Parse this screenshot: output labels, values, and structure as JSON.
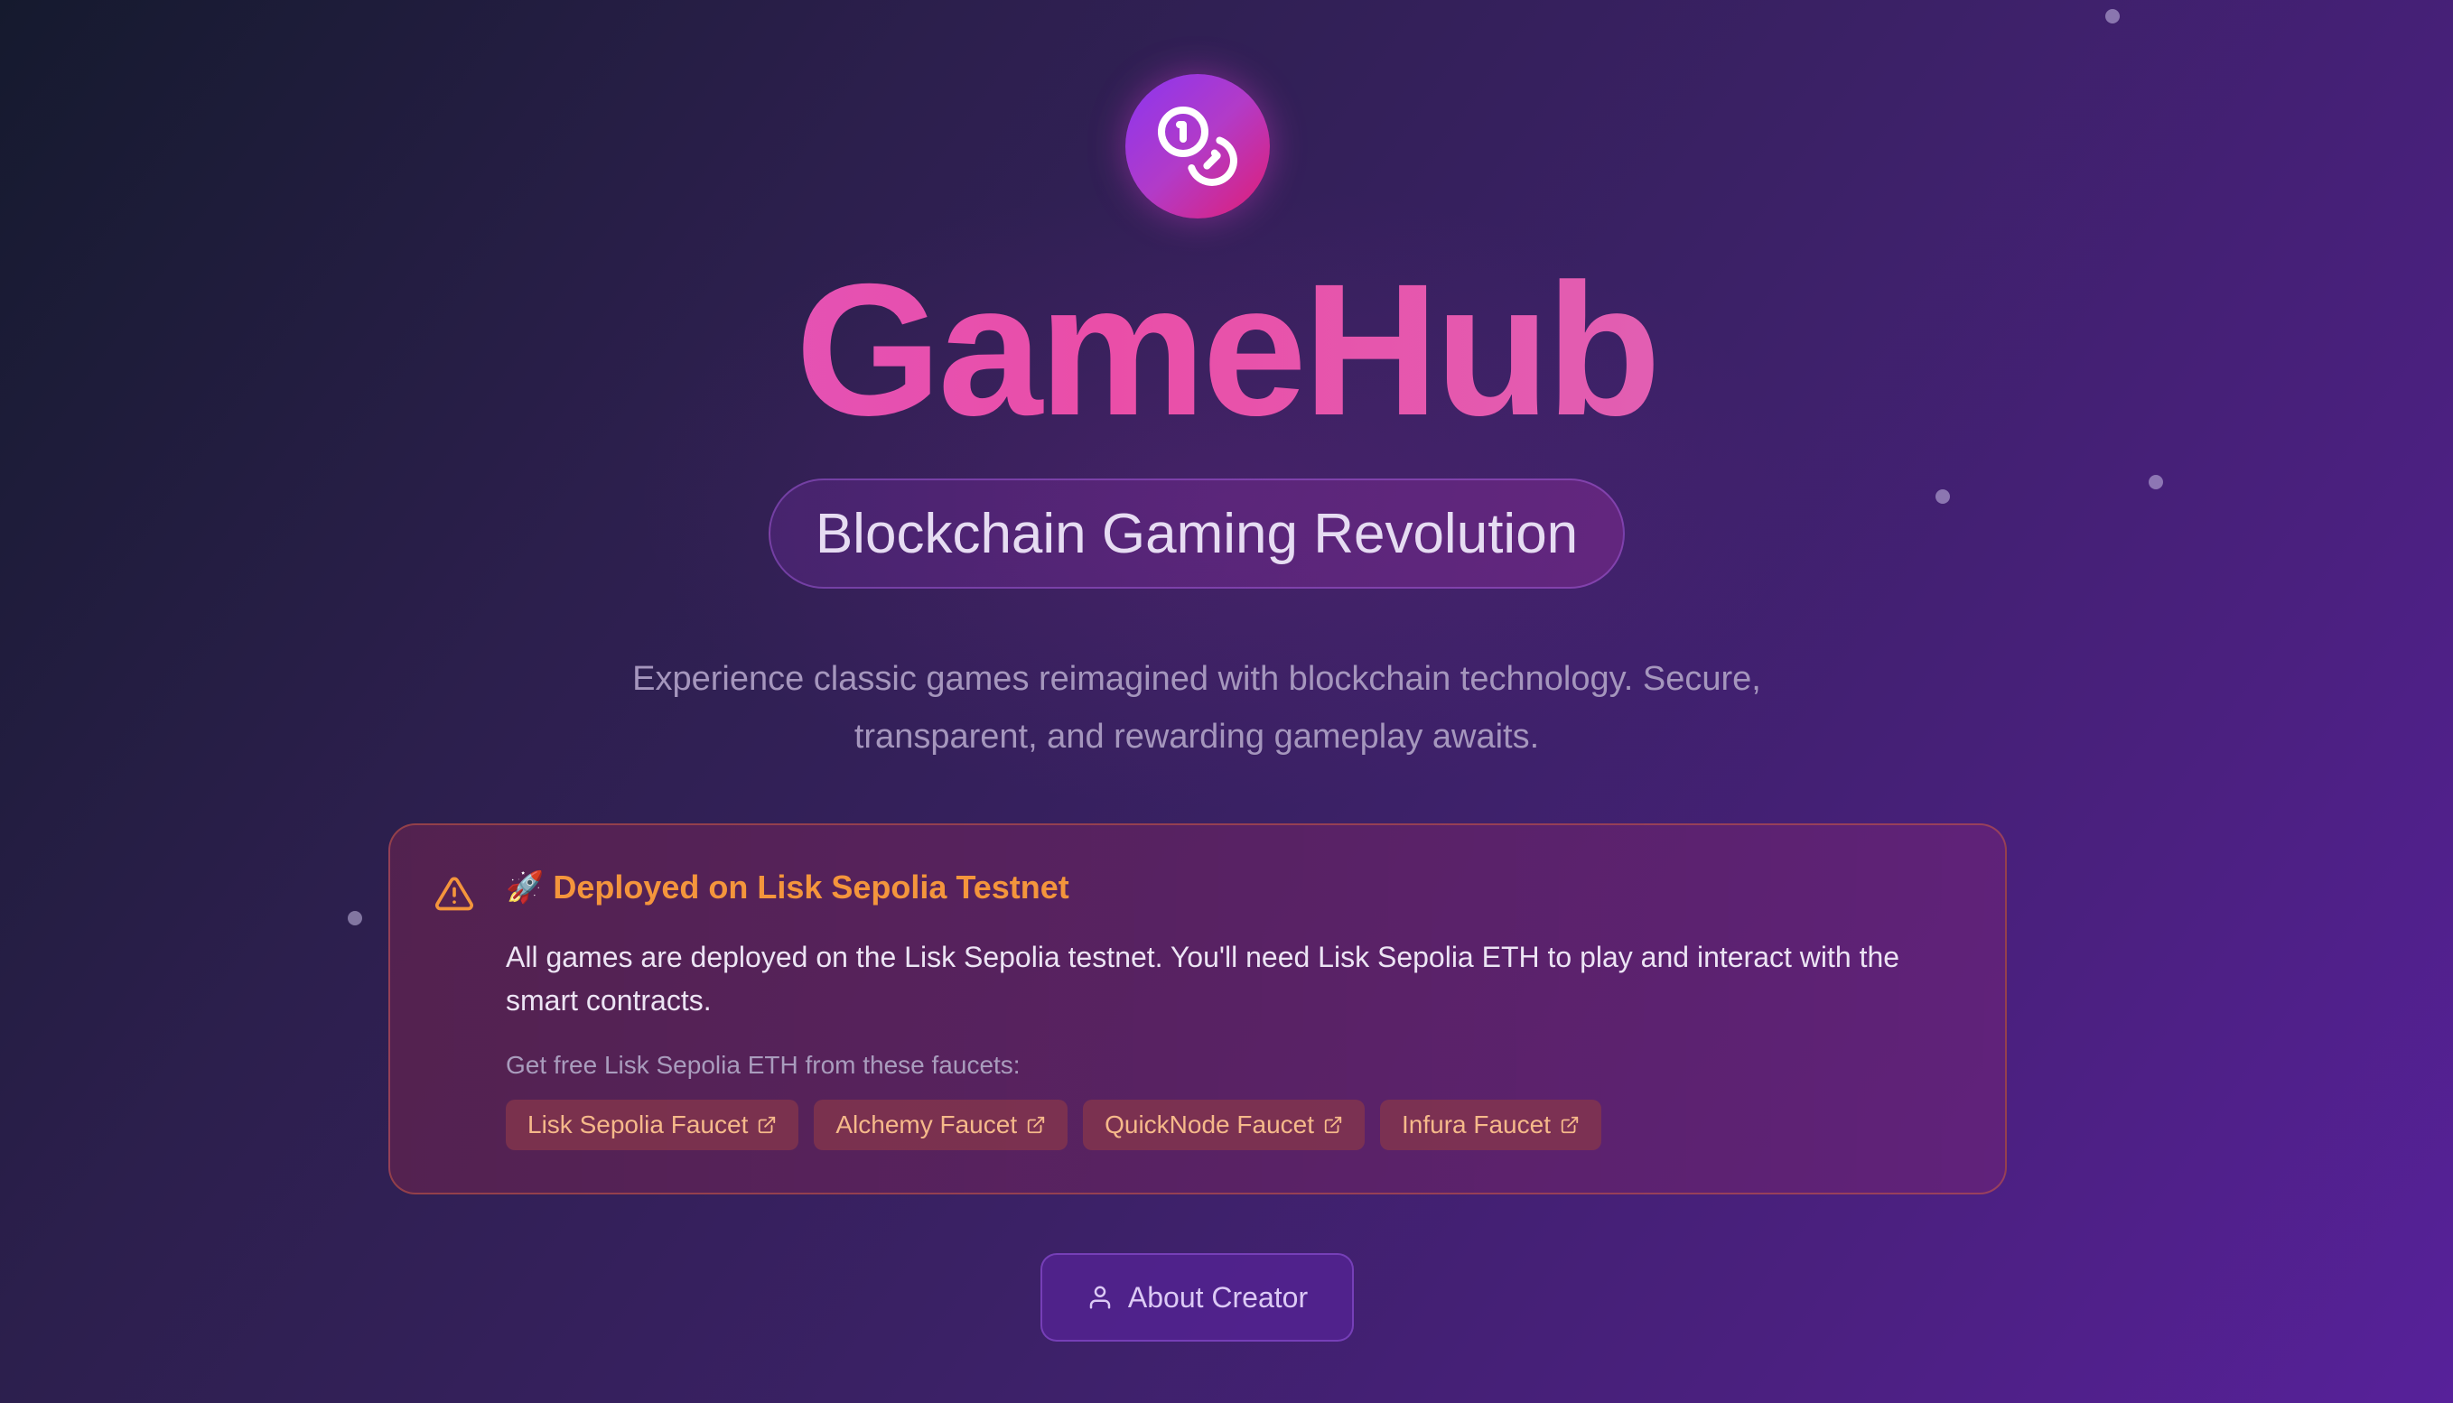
{
  "hero": {
    "logo_icon": "coins-icon",
    "title": "GameHub",
    "tagline": "Blockchain Gaming Revolution",
    "description": "Experience classic games reimagined with blockchain technology. Secure, transparent, and rewarding gameplay awaits."
  },
  "notice": {
    "icon": "warning-triangle-icon",
    "rocket": "🚀",
    "title": "Deployed on Lisk Sepolia Testnet",
    "body": "All games are deployed on the Lisk Sepolia testnet. You'll need Lisk Sepolia ETH to play and interact with the smart contracts.",
    "faucet_prompt": "Get free Lisk Sepolia ETH from these faucets:",
    "faucets": [
      {
        "label": "Lisk Sepolia Faucet",
        "icon": "external-link-icon"
      },
      {
        "label": "Alchemy Faucet",
        "icon": "external-link-icon"
      },
      {
        "label": "QuickNode Faucet",
        "icon": "external-link-icon"
      },
      {
        "label": "Infura Faucet",
        "icon": "external-link-icon"
      }
    ]
  },
  "about": {
    "label": "About Creator",
    "icon": "user-icon"
  },
  "colors": {
    "accent_orange": "#f4953c",
    "title_pink": "#ea4ea8",
    "logo_start": "#8b35f0",
    "logo_end": "#e11d74"
  }
}
